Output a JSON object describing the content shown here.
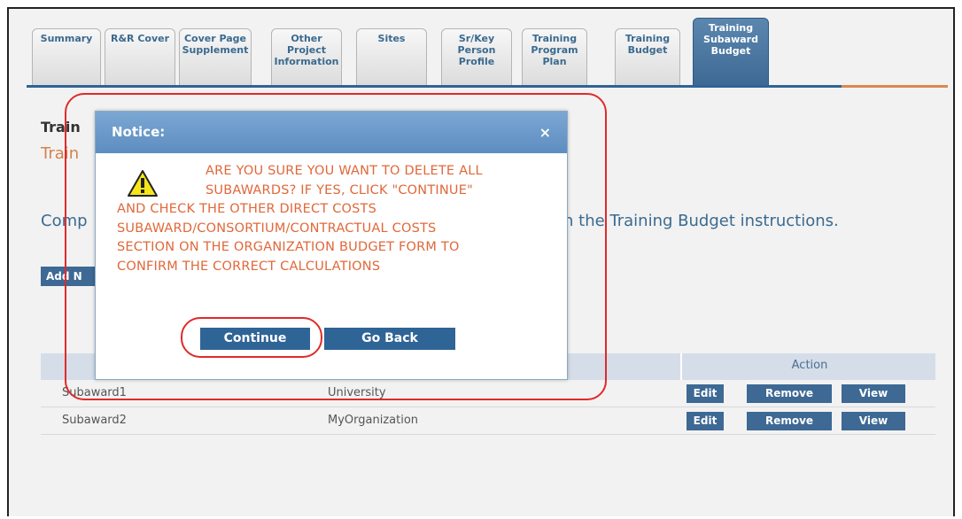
{
  "tabs": [
    {
      "label": "Summary"
    },
    {
      "label": "R&R Cover"
    },
    {
      "label": "Cover Page\nSupplement"
    },
    {
      "label": "Other\nProject\nInformation"
    },
    {
      "label": "Sites"
    },
    {
      "label": "Sr/Key\nPerson\nProfile"
    },
    {
      "label": "Training\nProgram\nPlan"
    },
    {
      "label": "Training\nBudget"
    },
    {
      "label": "Training\nSubaward\nBudget"
    }
  ],
  "page": {
    "heading": "Train",
    "subheading": "Train",
    "instructions_start": "Comp",
    "instructions_end": "n the Training Budget instructions.",
    "add_button": "Add N"
  },
  "grid": {
    "action_header": "Action",
    "rows": [
      {
        "name": "Subaward1",
        "org": "University",
        "edit": "Edit",
        "remove": "Remove",
        "view": "View"
      },
      {
        "name": "Subaward2",
        "org": "MyOrganization",
        "edit": "Edit",
        "remove": "Remove",
        "view": "View"
      }
    ]
  },
  "dialog": {
    "title": "Notice:",
    "close": "×",
    "message_lines": [
      "ARE YOU SURE YOU WANT TO DELETE ALL",
      "SUBAWARDS? IF YES, CLICK \"CONTINUE\"",
      "AND CHECK THE OTHER DIRECT COSTS",
      "SUBAWARD/CONSORTIUM/CONTRACTUAL COSTS",
      "SECTION ON THE ORGANIZATION BUDGET FORM TO",
      "CONFIRM THE CORRECT CALCULATIONS"
    ],
    "continue_label": "Continue",
    "goback_label": "Go Back",
    "icon": "warning-icon"
  },
  "colors": {
    "accent_blue": "#3d6994",
    "warning_text": "#e0683a",
    "highlight_red": "#e02a2a"
  }
}
